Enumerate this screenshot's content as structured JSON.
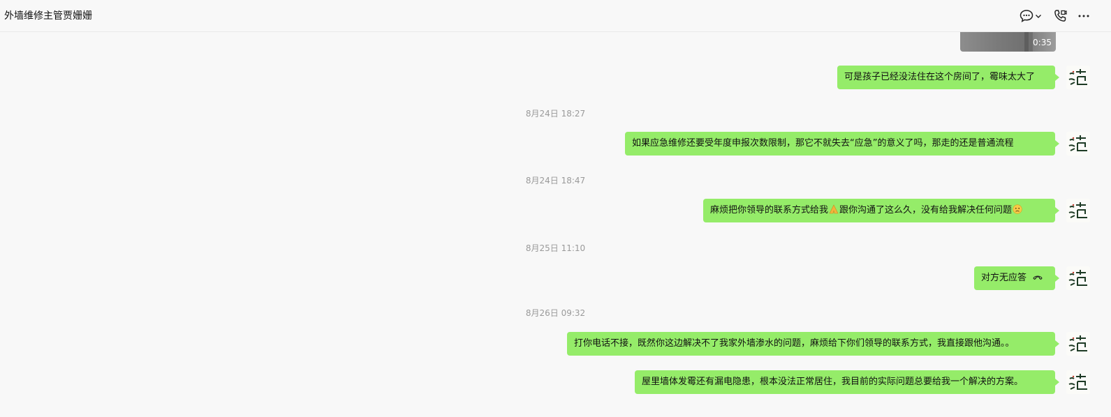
{
  "header": {
    "title": "外墙维修主管贾姗姗"
  },
  "video": {
    "duration": "0:35"
  },
  "messages": [
    {
      "text": "可是孩子已经没法住在这个房间了，霉味太大了"
    },
    {
      "text": "如果应急维修还要受年度申报次数限制，那它不就失去“应急”的意义了吗，那走的还是普通流程"
    },
    {
      "text_before": "麻烦把你领导的联系方式给我",
      "text_after": "跟你沟通了这么久，没有给我解决任何问题"
    },
    {
      "text": "对方无应答"
    },
    {
      "text": "打你电话不接，既然你这边解决不了我家外墙渗水的问题，麻烦给下你们领导的联系方式，我直接跟他沟通。。"
    },
    {
      "text": "屋里墙体发霉还有漏电隐患，根本没法正常居住，我目前的实际问题总要给我一个解决的方案。"
    }
  ],
  "timestamps": [
    "8月24日 18:27",
    "8月24日 18:47",
    "8月25日 11:10",
    "8月26日 09:32"
  ],
  "icons": {
    "chat": "chat-bubble-icon",
    "dropdown": "chevron-down-icon",
    "call": "phone-video-icon",
    "more": "more-icon",
    "emoji_pray": "pray-emoji-icon",
    "emoji_sad": "sad-emoji-icon",
    "hangup": "hangup-phone-icon",
    "avatar": "avatar"
  },
  "colors": {
    "bubble": "#95ec69",
    "background": "#f8f8f8",
    "timestamp": "#9a9a9a"
  }
}
